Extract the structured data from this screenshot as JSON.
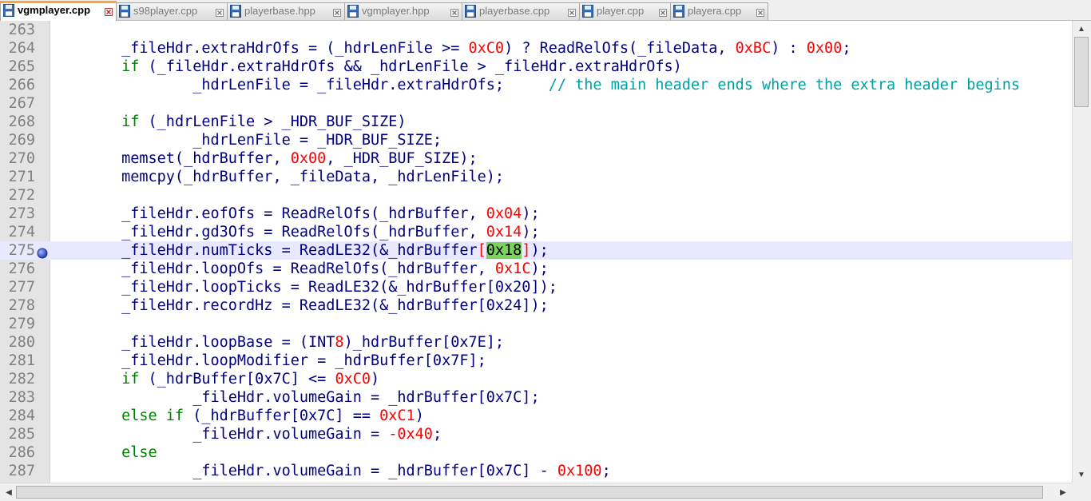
{
  "tabs": [
    {
      "label": "vgmplayer.cpp",
      "active": true
    },
    {
      "label": "s98player.cpp",
      "active": false
    },
    {
      "label": "playerbase.hpp",
      "active": false
    },
    {
      "label": "vgmplayer.hpp",
      "active": false
    },
    {
      "label": "playerbase.cpp",
      "active": false
    },
    {
      "label": "player.cpp",
      "active": false
    },
    {
      "label": "playera.cpp",
      "active": false
    }
  ],
  "editor": {
    "current_line": 275,
    "bookmark_line": 275,
    "lines": [
      {
        "num": "263",
        "tokens": []
      },
      {
        "num": "264",
        "tokens": [
          [
            "id",
            "        _fileHdr.extraHdrOfs = ("
          ],
          [
            "id",
            "_hdrLenFile >= "
          ],
          [
            "num",
            "0xC0"
          ],
          [
            "id",
            ") ? ReadRelOfs(_fileData, "
          ],
          [
            "num",
            "0xBC"
          ],
          [
            "id",
            ") : "
          ],
          [
            "num",
            "0x00"
          ],
          [
            "id",
            ";"
          ]
        ]
      },
      {
        "num": "265",
        "tokens": [
          [
            "kw",
            "        if"
          ],
          [
            "id",
            " (_fileHdr.extraHdrOfs && _hdrLenFile > _fileHdr.extraHdrOfs)"
          ]
        ]
      },
      {
        "num": "266",
        "tokens": [
          [
            "id",
            "                _hdrLenFile = _fileHdr.extraHdrOfs;     "
          ],
          [
            "cm",
            "// the main header ends where the extra header begins"
          ]
        ]
      },
      {
        "num": "267",
        "tokens": []
      },
      {
        "num": "268",
        "tokens": [
          [
            "kw",
            "        if"
          ],
          [
            "id",
            " (_hdrLenFile > _HDR_BUF_SIZE)"
          ]
        ]
      },
      {
        "num": "269",
        "tokens": [
          [
            "id",
            "                _hdrLenFile = _HDR_BUF_SIZE;"
          ]
        ]
      },
      {
        "num": "270",
        "tokens": [
          [
            "id",
            "        memset(_hdrBuffer, "
          ],
          [
            "num",
            "0x00"
          ],
          [
            "id",
            ", _HDR_BUF_SIZE);"
          ]
        ]
      },
      {
        "num": "271",
        "tokens": [
          [
            "id",
            "        memcpy(_hdrBuffer, _fileData, _hdrLenFile);"
          ]
        ]
      },
      {
        "num": "272",
        "tokens": []
      },
      {
        "num": "273",
        "tokens": [
          [
            "id",
            "        _fileHdr.eofOfs = ReadRelOfs(_hdrBuffer, "
          ],
          [
            "num",
            "0x04"
          ],
          [
            "id",
            ");"
          ]
        ]
      },
      {
        "num": "274",
        "tokens": [
          [
            "id",
            "        _fileHdr.gd3Ofs = ReadRelOfs(_hdrBuffer, "
          ],
          [
            "num",
            "0x14"
          ],
          [
            "id",
            ");"
          ]
        ]
      },
      {
        "num": "275",
        "tokens": [
          [
            "id",
            "        _fileHdr.numTicks = ReadLE32(&_hdrBuffer"
          ],
          [
            "br",
            "["
          ],
          [
            "hl",
            "0x18"
          ],
          [
            "br",
            "]"
          ],
          [
            "id",
            ");"
          ]
        ]
      },
      {
        "num": "276",
        "tokens": [
          [
            "id",
            "        _fileHdr.loopOfs = ReadRelOfs(_hdrBuffer, "
          ],
          [
            "num",
            "0x1C"
          ],
          [
            "id",
            ");"
          ]
        ]
      },
      {
        "num": "277",
        "tokens": [
          [
            "id",
            "        _fileHdr.loopTicks = ReadLE32(&_hdrBuffer[0x20]);"
          ]
        ]
      },
      {
        "num": "278",
        "tokens": [
          [
            "id",
            "        _fileHdr.recordHz = ReadLE32(&_hdrBuffer[0x24]);"
          ]
        ]
      },
      {
        "num": "279",
        "tokens": []
      },
      {
        "num": "280",
        "tokens": [
          [
            "id",
            "        _fileHdr.loopBase = (INT"
          ],
          [
            "num",
            "8"
          ],
          [
            "id",
            ")_hdrBuffer[0x7E];"
          ]
        ]
      },
      {
        "num": "281",
        "tokens": [
          [
            "id",
            "        _fileHdr.loopModifier = _hdrBuffer[0x7F];"
          ]
        ]
      },
      {
        "num": "282",
        "tokens": [
          [
            "kw",
            "        if"
          ],
          [
            "id",
            " (_hdrBuffer[0x7C] <= "
          ],
          [
            "num",
            "0xC0"
          ],
          [
            "id",
            ")"
          ]
        ]
      },
      {
        "num": "283",
        "tokens": [
          [
            "id",
            "                _fileHdr.volumeGain = _hdrBuffer[0x7C];"
          ]
        ]
      },
      {
        "num": "284",
        "tokens": [
          [
            "kw",
            "        else if"
          ],
          [
            "id",
            " (_hdrBuffer[0x7C] == "
          ],
          [
            "num",
            "0xC1"
          ],
          [
            "id",
            ")"
          ]
        ]
      },
      {
        "num": "285",
        "tokens": [
          [
            "id",
            "                _fileHdr.volumeGain = "
          ],
          [
            "num",
            "-0x40"
          ],
          [
            "id",
            ";"
          ]
        ]
      },
      {
        "num": "286",
        "tokens": [
          [
            "kw",
            "        else"
          ]
        ]
      },
      {
        "num": "287",
        "tokens": [
          [
            "id",
            "                _fileHdr.volumeGain = _hdrBuffer[0x7C] - "
          ],
          [
            "num",
            "0x100"
          ],
          [
            "id",
            ";"
          ]
        ]
      }
    ]
  },
  "colors": {
    "keyword": "#008000",
    "number": "#ff0000",
    "comment": "#00a0a0",
    "identifier": "#000080",
    "current_line": "#e8e8ff",
    "match_highlight": "#79d35e",
    "active_tab_accent": "#f7a73a"
  },
  "icons": {
    "tab_icon": "floppy-disk-icon",
    "tab_close": "close-icon",
    "bookmark": "bookmark-icon",
    "scroll_up": "arrow-up-icon",
    "scroll_down": "arrow-down-icon",
    "scroll_left": "arrow-left-icon",
    "scroll_right": "arrow-right-icon"
  }
}
